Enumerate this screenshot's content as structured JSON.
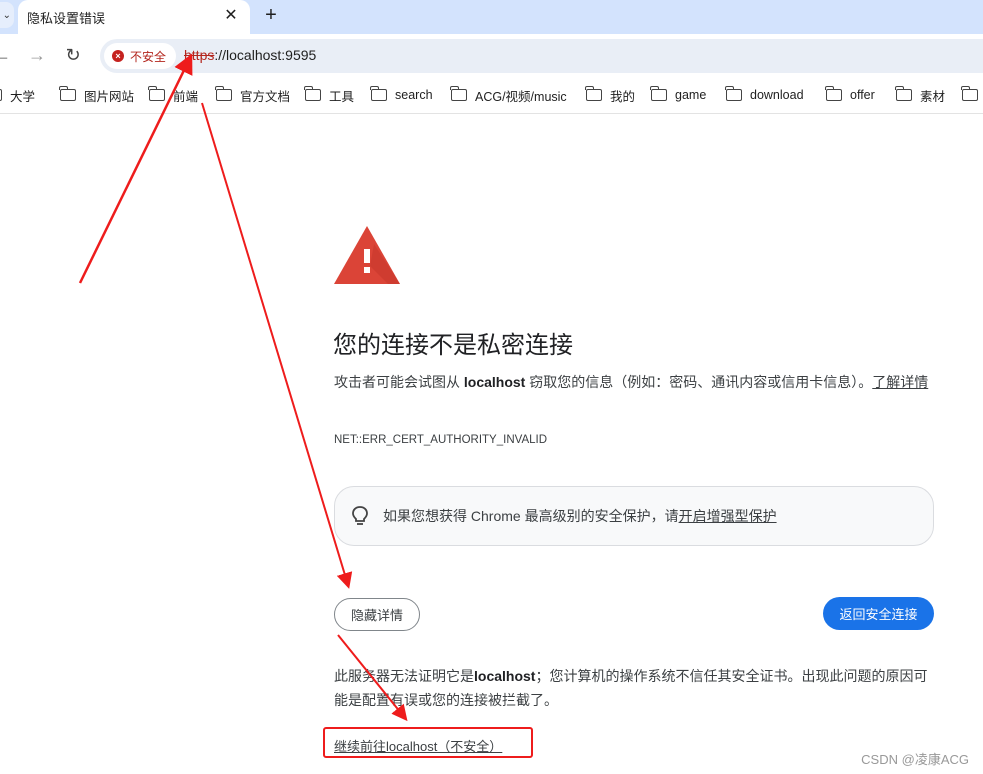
{
  "browser": {
    "tab": {
      "title": "隐私设置错误",
      "close_icon": "close-icon"
    },
    "new_tab_icon": "plus-icon",
    "nav": {
      "back_icon": "arrow-left-icon",
      "forward_icon": "arrow-right-icon",
      "reload_icon": "reload-icon"
    },
    "omnibox": {
      "security_chip": {
        "icon": "error-circle-icon",
        "label": "不安全"
      },
      "url_scheme": "https",
      "url_rest": "://localhost:9595"
    },
    "bookmarks": [
      {
        "label": "大学",
        "icon": "folder-icon"
      },
      {
        "label": "图片网站",
        "icon": "folder-icon"
      },
      {
        "label": "前端",
        "icon": "folder-icon"
      },
      {
        "label": "官方文档",
        "icon": "folder-icon"
      },
      {
        "label": "工具",
        "icon": "folder-icon"
      },
      {
        "label": "search",
        "icon": "folder-icon"
      },
      {
        "label": "ACG/视频/music",
        "icon": "folder-icon"
      },
      {
        "label": "我的",
        "icon": "folder-icon"
      },
      {
        "label": "game",
        "icon": "folder-icon"
      },
      {
        "label": "download",
        "icon": "folder-icon"
      },
      {
        "label": "offer",
        "icon": "folder-icon"
      },
      {
        "label": "素材",
        "icon": "folder-icon"
      },
      {
        "label": "",
        "icon": "folder-icon"
      }
    ]
  },
  "page": {
    "warning_icon": "warning-triangle-icon",
    "heading": "您的连接不是私密连接",
    "explanation_pre": "攻击者可能会试图从 ",
    "explanation_host": "localhost",
    "explanation_post": " 窃取您的信息（例如：密码、通讯内容或信用卡信息）。",
    "learn_more": "了解详情",
    "error_code": "NET::ERR_CERT_AUTHORITY_INVALID",
    "enhanced_protection": {
      "icon": "lightbulb-icon",
      "text": "如果您想获得 Chrome 最高级别的安全保护，请",
      "link": "开启增强型保护"
    },
    "hide_details_button": "隐藏详情",
    "back_to_safety_button": "返回安全连接",
    "details_pre": "此服务器无法证明它是",
    "details_host": "localhost",
    "details_post": "；您计算机的操作系统不信任其安全证书。出现此问题的原因可能是配置有误或您的连接被拦截了。",
    "proceed_link": "继续前往localhost（不安全）"
  },
  "annotation": {
    "color": "#ee1c1c",
    "watermark": "CSDN @凌康ACG"
  }
}
